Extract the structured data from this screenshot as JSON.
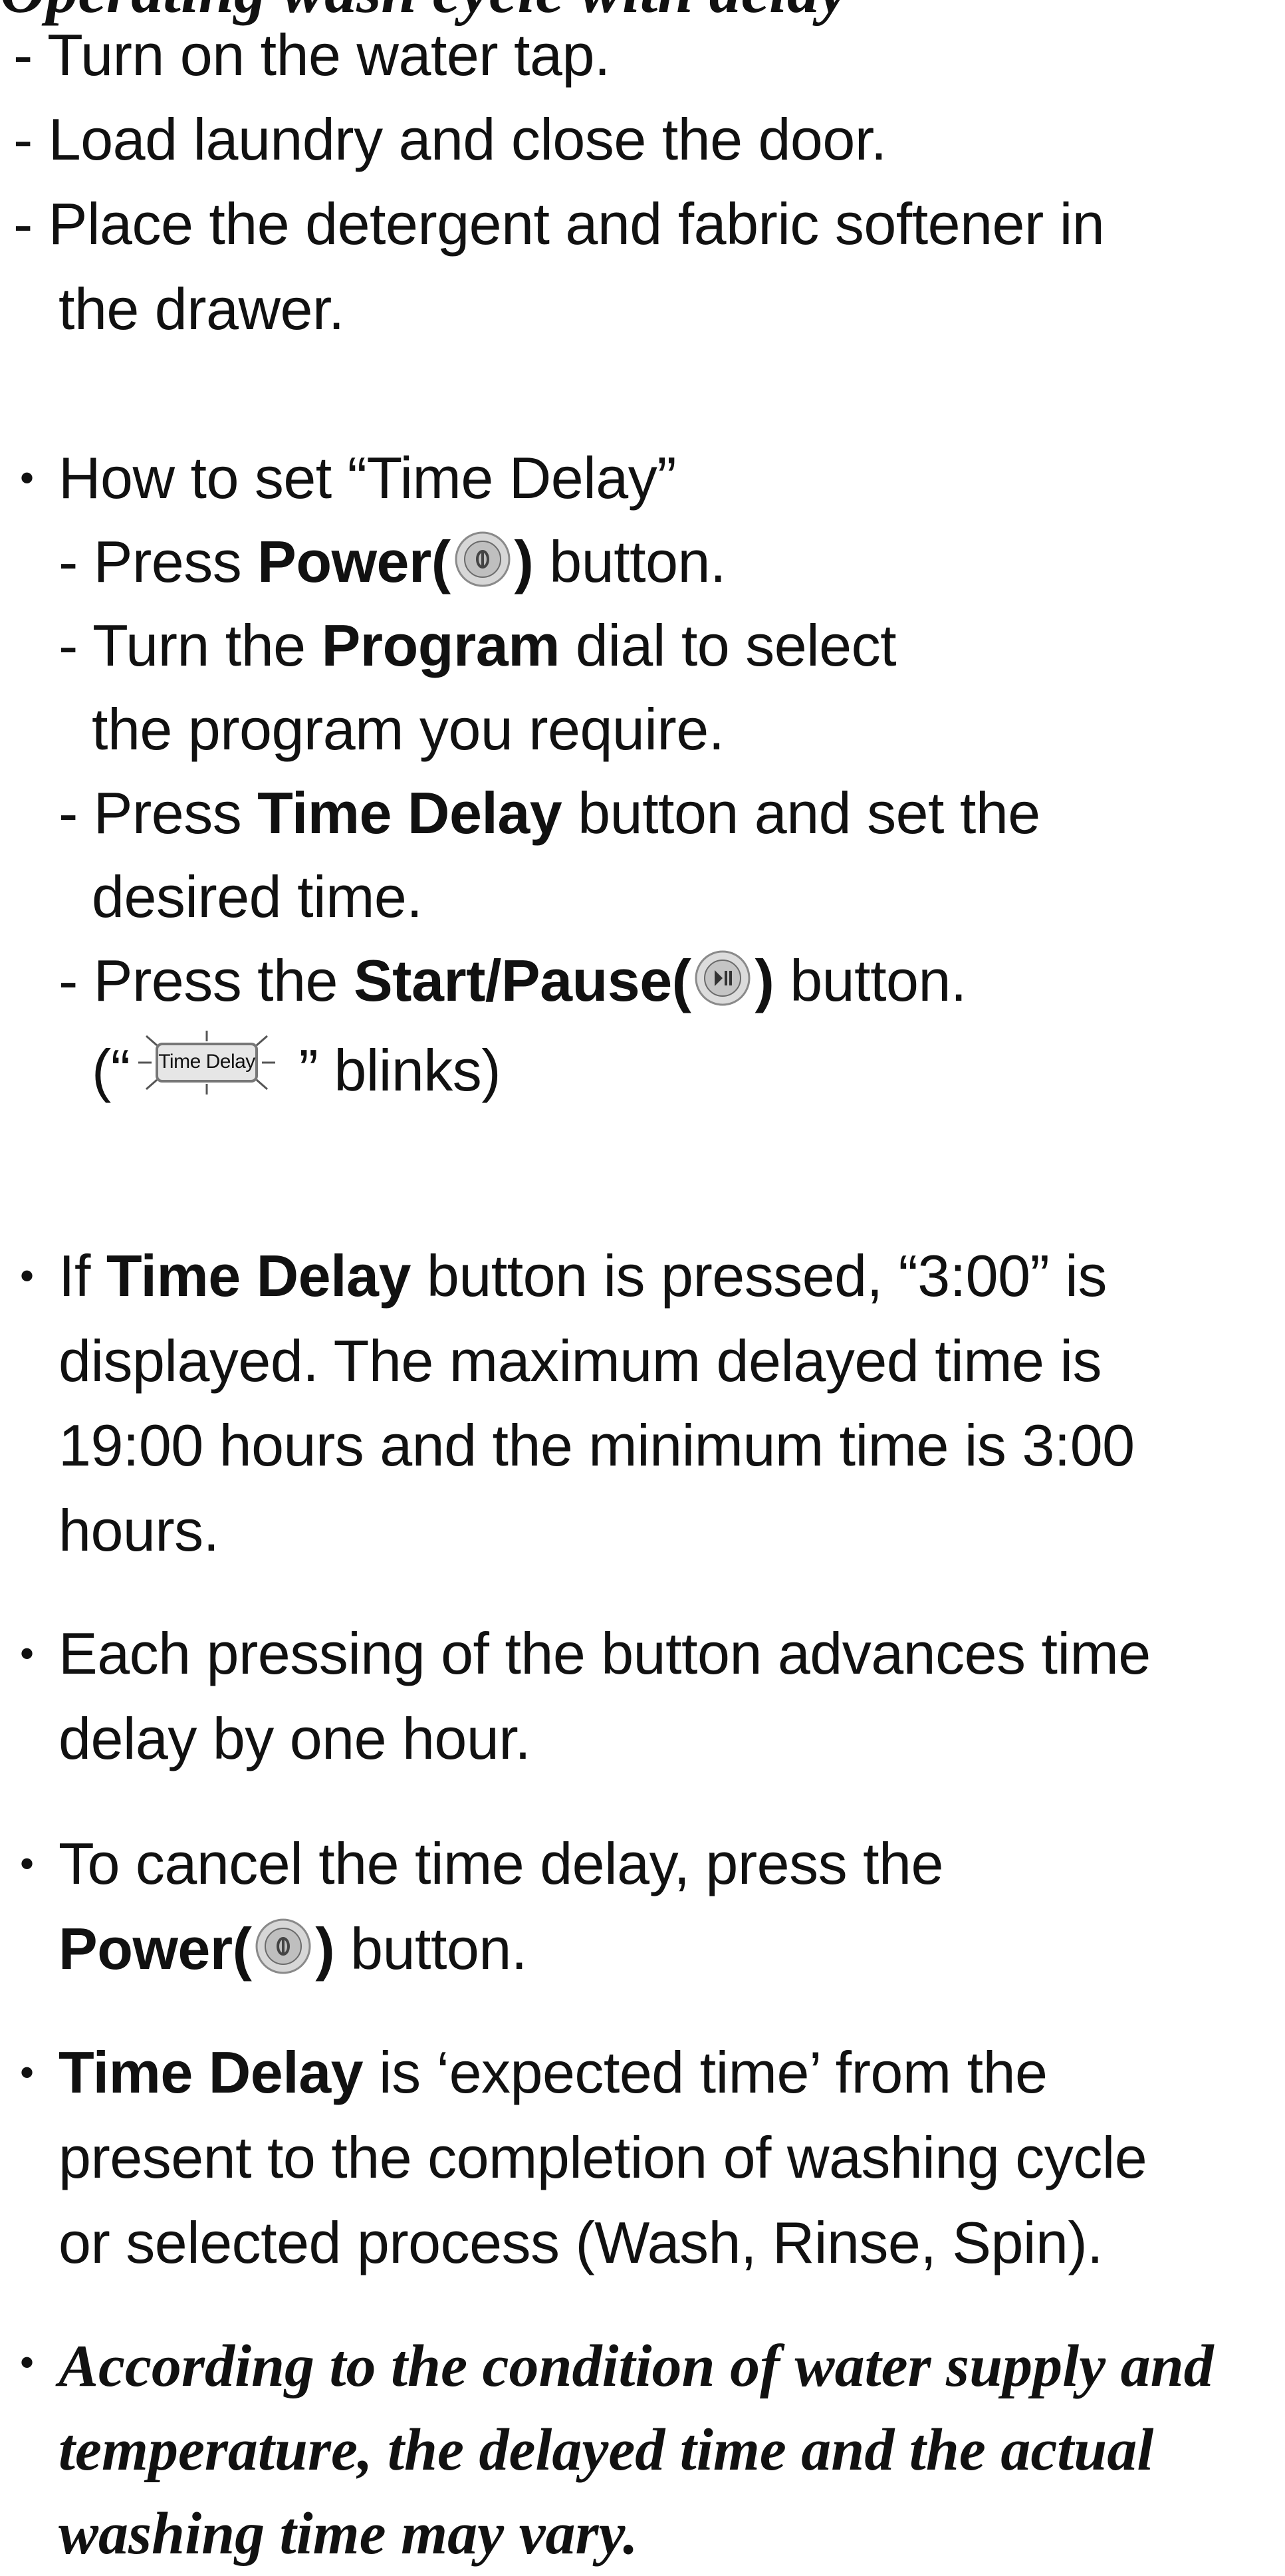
{
  "clipped_header": "Operating wash cycle with delay",
  "steps": [
    "Turn on the water tap.",
    "Load laundry and close the door.",
    "Place the detergent and fabric softener in",
    "the drawer."
  ],
  "howto": {
    "heading": "How to set “Time Delay”",
    "press": "- Press ",
    "power_label": "Power(",
    "close_paren": ")",
    "button_word": " button.",
    "turn_the": "- Turn the ",
    "program_label": "Program",
    "dial_to_select": " dial to select",
    "program_line2": "the program you require.",
    "press2": "- Press ",
    "time_delay_label": "Time Delay",
    "button_and_set": " button and set the",
    "desired_time": "desired time.",
    "press_the": "- Press the ",
    "start_pause_label": "Start/Pause(",
    "close_paren2": ")",
    "button_word2": " button.",
    "blinks_open": "(“",
    "badge_text": "Time Delay",
    "blinks_close": " ” blinks)"
  },
  "notes": {
    "n1_if": "If ",
    "n1_bold": "Time Delay",
    "n1_rest": " button is pressed, “3:00” is",
    "n1_l2": "displayed. The maximum delayed time is",
    "n1_l3": "19:00 hours and the minimum time is 3:00",
    "n1_l4": "hours.",
    "n2_l1": "Each pressing of the button advances time",
    "n2_l2": "delay by one hour.",
    "n3_l1": "To cancel the time delay, press the",
    "n3_bold": "Power(",
    "n3_close": ")",
    "n3_rest": " button.",
    "n4_bold": "Time Delay",
    "n4_rest": " is ‘expected time’ from the",
    "n4_l2": "present to the completion of washing cycle",
    "n4_l3": "or selected process (Wash, Rinse, Spin).",
    "n5_l1": "According to the condition of water supply and",
    "n5_l2": "temperature, the delayed time and the actual",
    "n5_l3": "washing time may vary."
  },
  "icons": {
    "power": "power-button-icon",
    "start_pause": "start-pause-button-icon"
  },
  "bullet_char": "•",
  "dash_char": "-"
}
